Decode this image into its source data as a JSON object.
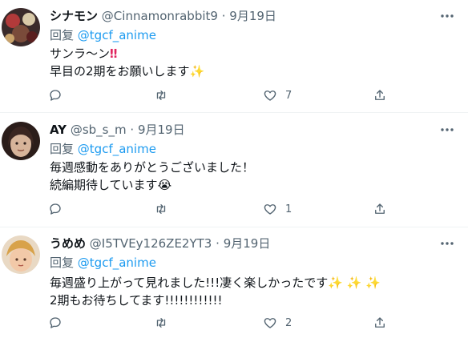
{
  "tweets": [
    {
      "name": "シナモン",
      "handle": "@Cinnamonrabbit9",
      "dot": "·",
      "date": "9月19日",
      "reply_prefix": "回复",
      "reply_to": "@tgcf_anime",
      "lines": [
        "サンラ〜ン",
        "早目の2期をお願いします"
      ],
      "emoji1": "‼",
      "emoji2": "✨",
      "like_count": "7"
    },
    {
      "name": "AY",
      "handle": "@sb_s_m",
      "dot": "·",
      "date": "9月19日",
      "reply_prefix": "回复",
      "reply_to": "@tgcf_anime",
      "lines": [
        "毎週感動をありがとうございました！",
        "続編期待しています"
      ],
      "emoji2": "😭",
      "like_count": "1"
    },
    {
      "name": "うめめ",
      "handle": "@I5TVEy126ZE2YT3",
      "dot": "·",
      "date": "9月19日",
      "reply_prefix": "回复",
      "reply_to": "@tgcf_anime",
      "lines": [
        "毎週盛り上がって見れました!!!凄く楽しかったです",
        "2期もお待ちしてます!!!!!!!!!!!!"
      ],
      "emoji1": "✨ ✨ ✨",
      "like_count": "2"
    }
  ],
  "icons": {
    "more": "more-icon",
    "reply": "reply-icon",
    "retweet": "retweet-icon",
    "like": "heart-icon",
    "share": "share-icon"
  },
  "colors": {
    "text": "#0f1419",
    "secondary": "#536471",
    "mention": "#1d9bf0",
    "divider": "#eff3f4"
  }
}
